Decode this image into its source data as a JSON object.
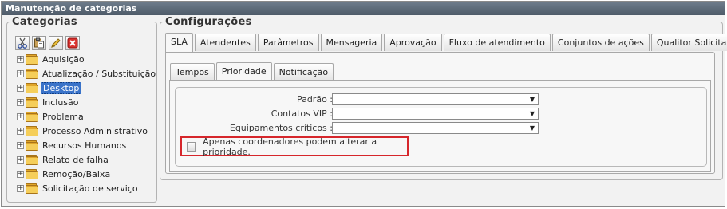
{
  "window": {
    "title": "Manutenção de categorias"
  },
  "categorias": {
    "legend": "Categorias",
    "toolbar": [
      {
        "name": "cut-icon"
      },
      {
        "name": "paste-icon"
      },
      {
        "name": "edit-icon"
      },
      {
        "name": "delete-icon"
      }
    ],
    "items": [
      {
        "label": "Aquisição",
        "expander": "+",
        "selected": false
      },
      {
        "label": "Atualização / Substituição",
        "expander": "+",
        "selected": false
      },
      {
        "label": "Desktop",
        "expander": "+",
        "selected": true
      },
      {
        "label": "Inclusão",
        "expander": "+",
        "selected": false
      },
      {
        "label": "Problema",
        "expander": "+",
        "selected": false
      },
      {
        "label": "Processo Administrativo",
        "expander": "+",
        "selected": false
      },
      {
        "label": "Recursos Humanos",
        "expander": "+",
        "selected": false
      },
      {
        "label": "Relato de falha",
        "expander": "+",
        "selected": false
      },
      {
        "label": "Remoção/Baixa",
        "expander": "+",
        "selected": false
      },
      {
        "label": "Solicitação de serviço",
        "expander": "+",
        "selected": false
      }
    ]
  },
  "configuracoes": {
    "legend": "Configurações",
    "tabs": [
      {
        "label": "SLA",
        "active": true
      },
      {
        "label": "Atendentes",
        "active": false
      },
      {
        "label": "Parâmetros",
        "active": false
      },
      {
        "label": "Mensageria",
        "active": false
      },
      {
        "label": "Aprovação",
        "active": false
      },
      {
        "label": "Fluxo de atendimento",
        "active": false
      },
      {
        "label": "Conjuntos de ações",
        "active": false
      },
      {
        "label": "Qualitor Solicitante",
        "active": false
      }
    ],
    "subtabs": [
      {
        "label": "Tempos",
        "active": false
      },
      {
        "label": "Prioridade",
        "active": true
      },
      {
        "label": "Notificação",
        "active": false
      }
    ],
    "form": {
      "padrao_label": "Padrão :",
      "padrao_value": "",
      "contatos_label": "Contatos VIP :",
      "contatos_value": "",
      "equip_label": "Equipamentos críticos :",
      "equip_value": "",
      "checkbox_label": "Apenas coordenadores podem alterar a prioridade.",
      "checkbox_checked": false,
      "highlight_color": "#d6262b"
    }
  }
}
